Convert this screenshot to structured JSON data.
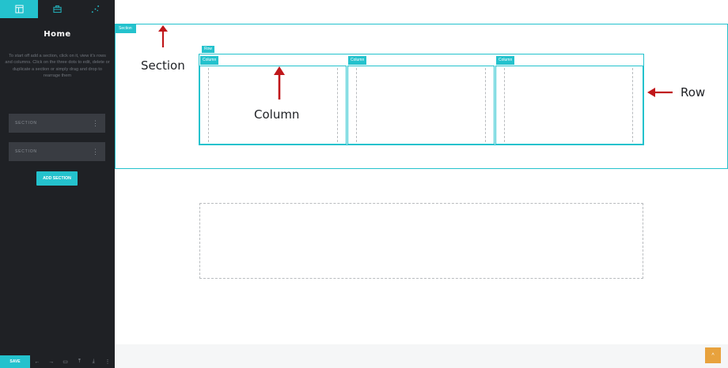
{
  "sidebar": {
    "tabs": [
      {
        "icon": "layout-icon",
        "active": true
      },
      {
        "icon": "briefcase-icon",
        "active": false
      },
      {
        "icon": "sparkle-icon",
        "active": false
      }
    ],
    "title": "Home",
    "description": "To start off add a section, click on it, view it's rows and columns. Click on the three dots to edit, delete or duplicate a section or simply drag and drop to rearrage them",
    "sections": [
      {
        "label": "SECTION",
        "menu": "⋮"
      },
      {
        "label": "SECTION",
        "menu": "⋮"
      }
    ],
    "add_section_label": "ADD SECTION",
    "bottom_bar": {
      "save_label": "SAVE",
      "icons": [
        "arrow-left-icon",
        "arrow-right-icon",
        "monitor-icon",
        "upload-icon",
        "download-icon",
        "more-icon"
      ],
      "glyphs": [
        "←",
        "→",
        "▭",
        "⤒",
        "⤓",
        "⋮"
      ]
    }
  },
  "canvas": {
    "section_tag": "Section",
    "row_tag": "Row",
    "column_tags": [
      "Column",
      "Column",
      "Column"
    ],
    "annotations": {
      "section": "Section",
      "column": "Column",
      "row": "Row"
    },
    "accent_color": "#24c2cd",
    "annotation_arrow_color": "#c0171b",
    "scroll_top_glyph": "^"
  }
}
